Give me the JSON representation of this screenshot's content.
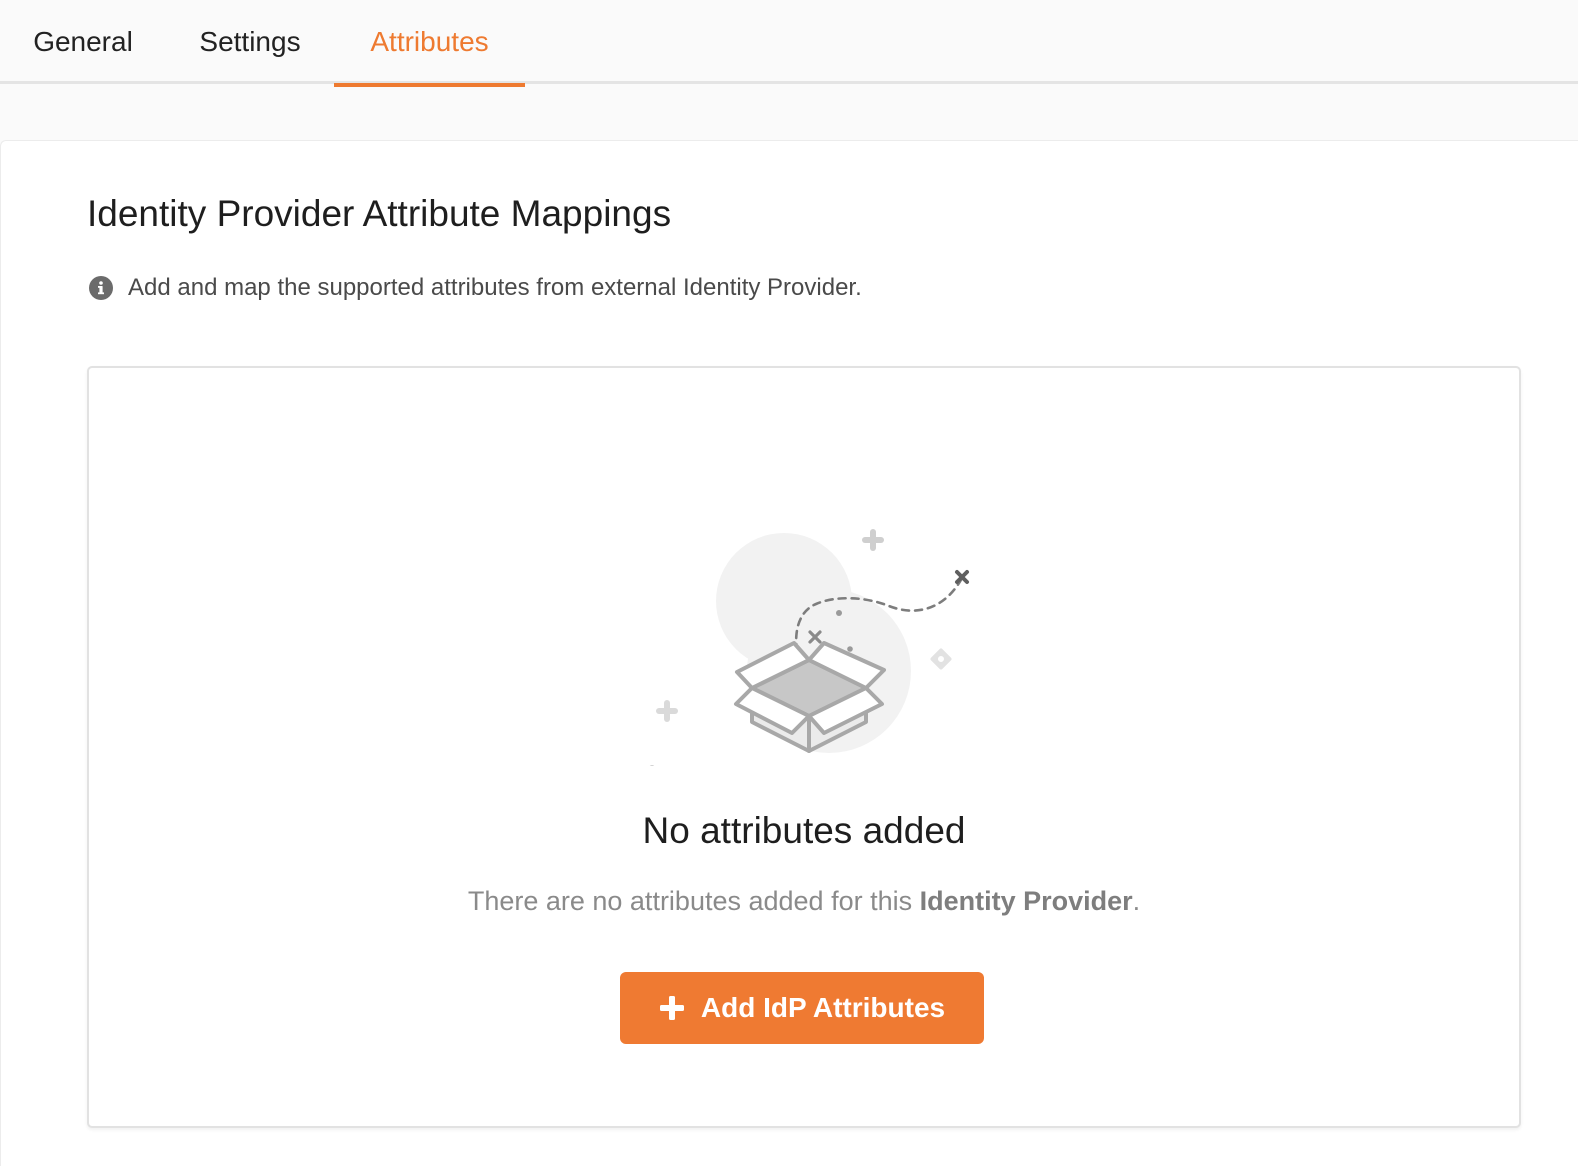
{
  "tabs": [
    {
      "label": "General",
      "active": false
    },
    {
      "label": "Settings",
      "active": false
    },
    {
      "label": "Attributes",
      "active": true
    }
  ],
  "accent_color": "#ee7a30",
  "section": {
    "title": "Identity Provider Attribute Mappings",
    "hint": "Add and map the supported attributes from external Identity Provider.",
    "hint_icon": "info-icon"
  },
  "empty_state": {
    "illustration": "open-box-illustration",
    "title": "No attributes added",
    "message_prefix": "There are no attributes added for this ",
    "message_emphasis": "Identity Provider",
    "message_suffix": ".",
    "button_icon": "plus-icon",
    "button_label": "Add IdP Attributes"
  }
}
